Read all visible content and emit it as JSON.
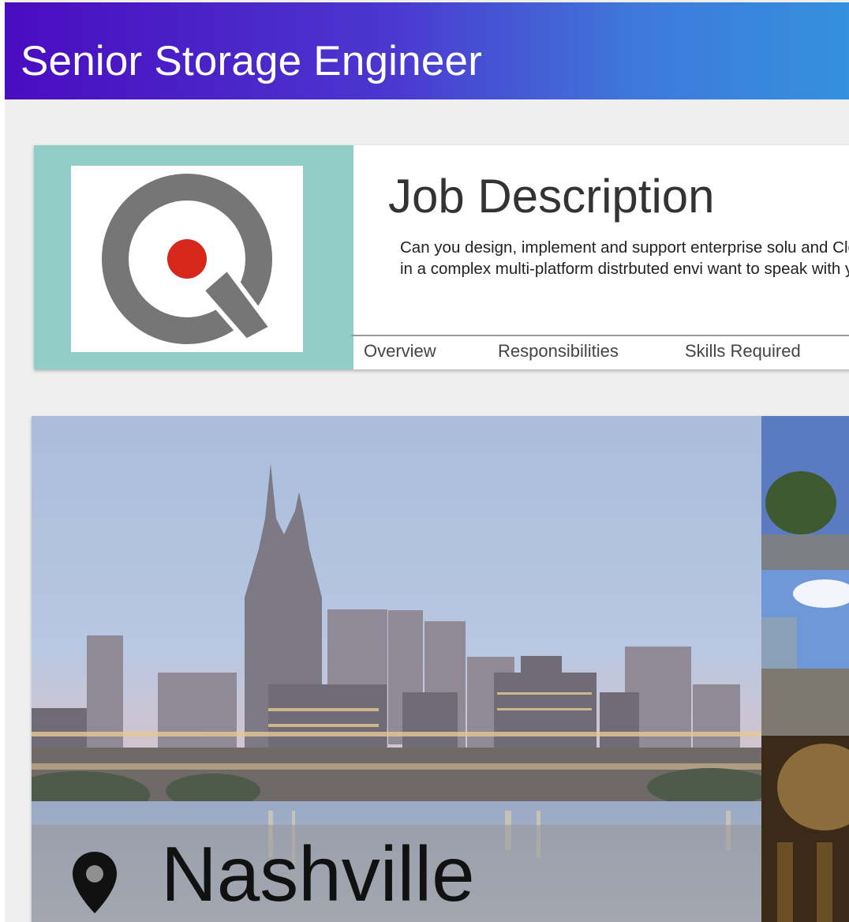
{
  "header": {
    "title": "Senior Storage Engineer"
  },
  "job": {
    "logo_icon": "company-q-logo",
    "title": "Job Description",
    "description": "Can you design, implement and support enterprise solu and Cloud) in a complex multi-platform distrbuted envi want to speak with you.",
    "tabs": [
      {
        "label": "Overview"
      },
      {
        "label": "Responsibilities"
      },
      {
        "label": "Skills Required"
      }
    ]
  },
  "location": {
    "icon": "map-pin-icon",
    "city": "Nashville"
  },
  "colors": {
    "header_start": "#4a0cc0",
    "header_end": "#3490e0",
    "logo_panel_bg": "#93cdc7",
    "logo_gray": "#767676",
    "logo_red": "#d9261c"
  }
}
